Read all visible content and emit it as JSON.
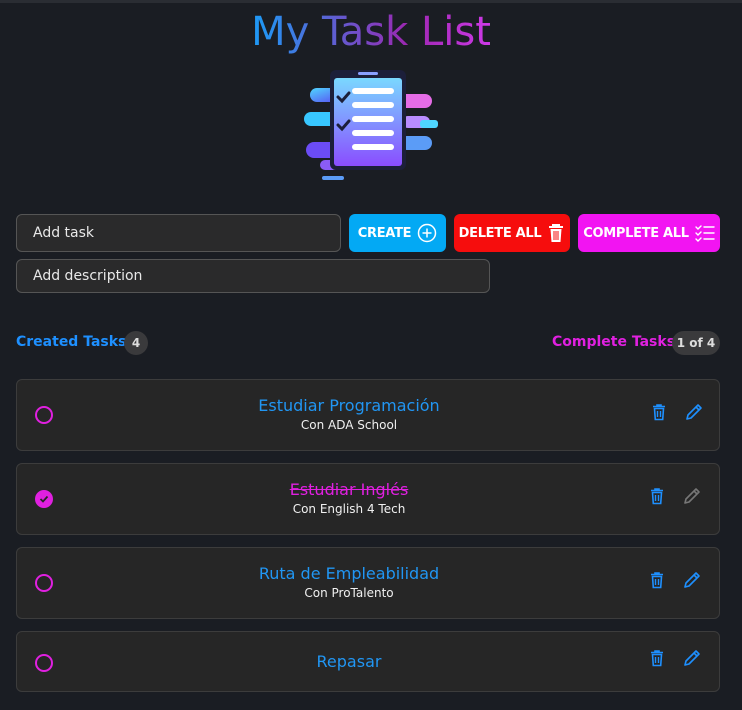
{
  "header": {
    "title": "My Task List"
  },
  "form": {
    "task_placeholder": "Add task",
    "description_placeholder": "Add description",
    "create_label": "CREATE",
    "delete_all_label": "DELETE ALL",
    "complete_all_label": "COMPLETE ALL"
  },
  "stats": {
    "created_label": "Created Tasks",
    "created_count": "4",
    "complete_label": "Complete Tasks",
    "complete_count": "1 of 4"
  },
  "tasks": [
    {
      "title": "Estudiar Programación",
      "description": "Con ADA School",
      "completed": false
    },
    {
      "title": "Estudiar Inglés",
      "description": "Con English 4 Tech",
      "completed": true
    },
    {
      "title": "Ruta de Empleabilidad",
      "description": "Con ProTalento",
      "completed": false
    },
    {
      "title": "Repasar",
      "description": "",
      "completed": false
    }
  ],
  "colors": {
    "background": "#1a1d23",
    "blue_accent": "#2196f3",
    "magenta_accent": "#e020e0",
    "create_button": "#03a9f4",
    "delete_button": "#f60d0d",
    "complete_button": "#f214f2"
  },
  "icons": [
    "task-list-illustration-icon",
    "plus-circle-icon",
    "trash-icon",
    "checklist-icon",
    "check-icon",
    "edit-icon"
  ]
}
